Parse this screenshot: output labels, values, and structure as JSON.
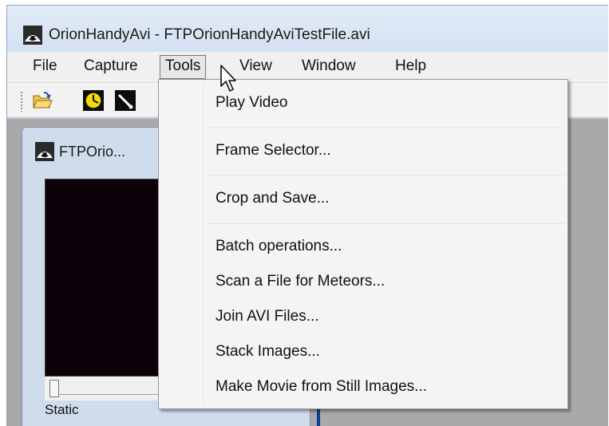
{
  "window": {
    "title": "OrionHandyAvi - FTPOrionHandyAviTestFile.avi",
    "icon": "app-icon"
  },
  "menubar": {
    "items": [
      {
        "label": "File"
      },
      {
        "label": "Capture"
      },
      {
        "label": "Tools"
      },
      {
        "label": "View"
      },
      {
        "label": "Window"
      },
      {
        "label": "Help"
      }
    ],
    "open_menu": "Tools"
  },
  "toolbar": {
    "buttons": [
      "open-folder-icon",
      "clock-icon",
      "wand-icon"
    ]
  },
  "child_window": {
    "title": "FTPOrio...",
    "status": "Static"
  },
  "tools_menu": {
    "items": [
      {
        "label": "Play Video"
      },
      {
        "label": "Frame Selector..."
      },
      {
        "label": "Crop and Save..."
      },
      {
        "label": "Batch operations..."
      },
      {
        "label": "Scan a File for Meteors..."
      },
      {
        "label": "Join AVI Files..."
      },
      {
        "label": "Stack Images..."
      },
      {
        "label": "Make Movie from Still Images..."
      }
    ]
  },
  "colors": {
    "menu_bg": "#f4f4f4",
    "video_bg": "#0c0008",
    "mdi_bg": "#a9a9a9"
  }
}
